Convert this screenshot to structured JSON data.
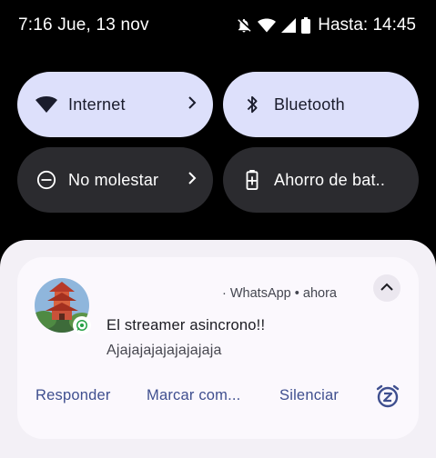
{
  "status_bar": {
    "time_date": "7:16 Jue, 13 nov",
    "battery_label": "Hasta: 14:45",
    "icons": [
      "notifications-off-icon",
      "wifi-icon",
      "cell-signal-icon",
      "battery-icon"
    ]
  },
  "quick_settings": {
    "tiles": [
      {
        "label": "Internet",
        "icon": "wifi-icon",
        "state": "on",
        "has_chevron": true
      },
      {
        "label": "Bluetooth",
        "icon": "bluetooth-icon",
        "state": "on",
        "has_chevron": false
      },
      {
        "label": "No molestar",
        "icon": "do-not-disturb-icon",
        "state": "off",
        "has_chevron": true
      },
      {
        "label": "Ahorro de bat..",
        "icon": "battery-saver-icon",
        "state": "off",
        "has_chevron": false
      }
    ]
  },
  "notification": {
    "app_name": "· WhatsApp",
    "time": "• ahora",
    "title": "El streamer asincrono!!",
    "text": "Ajajajajajajajajaja",
    "actions": [
      "Responder",
      "Marcar com...",
      "Silenciar"
    ],
    "icons": [
      "avatar-pagoda",
      "whatsapp-icon",
      "expand-less-icon",
      "snooze-icon"
    ]
  },
  "colors": {
    "tile_on": "#dde0fb",
    "tile_off": "#2b2b2f",
    "sheet_bg": "#f3f0f6",
    "card_bg": "#fbf8fd",
    "action_text": "#3f4f8f",
    "whatsapp_green": "#25a043"
  }
}
